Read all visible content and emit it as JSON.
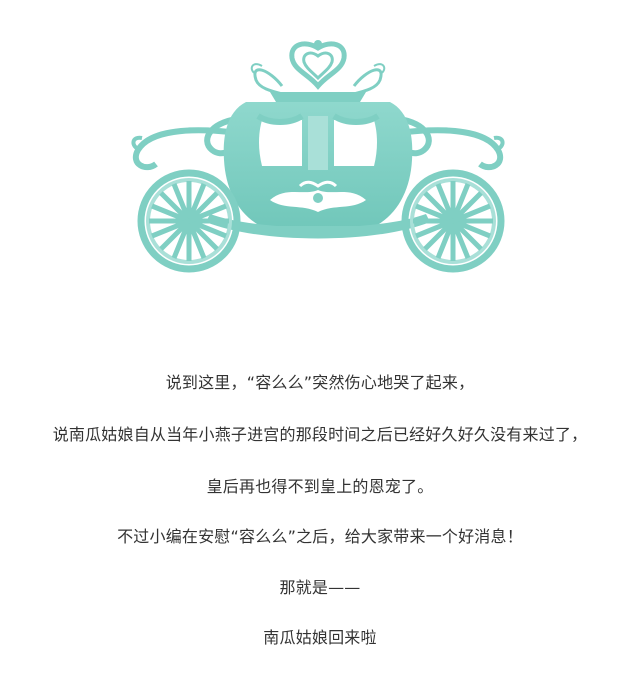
{
  "colors": {
    "carriage": "#7fcfc3",
    "carriage_light": "#a9e0d8",
    "text": "#333333",
    "background": "#ffffff"
  },
  "illustration": {
    "icon": "carriage-icon"
  },
  "story": {
    "lines": [
      "说到这里，“容么么”突然伤心地哭了起来，",
      "说南瓜姑娘自从当年小燕子进宫的那段时间之后已经好久好久没有来过了，",
      "皇后再也得不到皇上的恩宠了。",
      "不过小编在安慰“容么么”之后，给大家带来一个好消息！",
      "那就是——",
      "南瓜姑娘回来啦"
    ]
  }
}
